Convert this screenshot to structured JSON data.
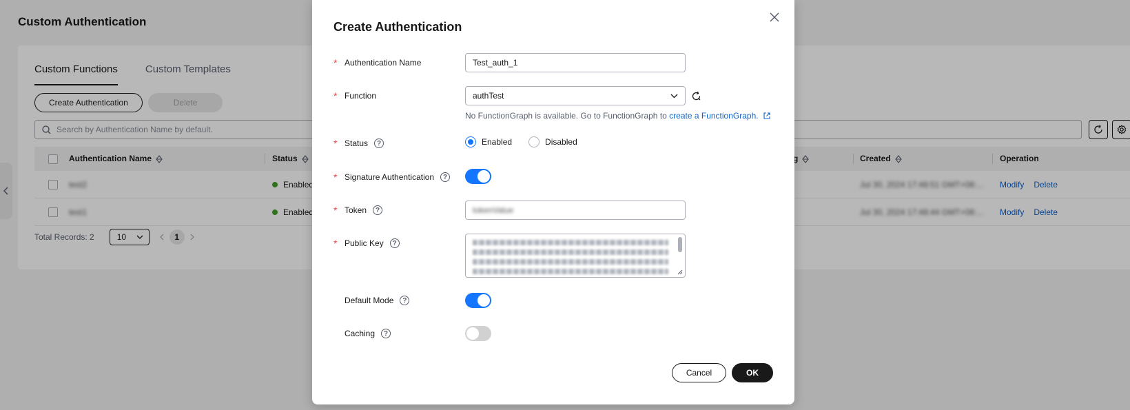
{
  "page": {
    "title": "Custom Authentication",
    "tabs": [
      {
        "label": "Custom Functions",
        "active": true
      },
      {
        "label": "Custom Templates",
        "active": false
      }
    ],
    "create_button": "Create Authentication",
    "delete_button": "Delete",
    "search_placeholder": "Search by Authentication Name by default.",
    "columns": {
      "name": "Authentication Name",
      "status": "Status",
      "partial": "g",
      "created": "Created",
      "operation": "Operation"
    },
    "rows": [
      {
        "name": "test2",
        "status": "Enabled",
        "created": "Jul 30, 2024 17:48:51 GMT+08:...",
        "modify": "Modify",
        "delete": "Delete"
      },
      {
        "name": "test1",
        "status": "Enabled",
        "created": "Jul 30, 2024 17:48:44 GMT+08:...",
        "modify": "Modify",
        "delete": "Delete"
      }
    ],
    "pager": {
      "total": "Total Records: 2",
      "page_size": "10",
      "current_page": "1"
    }
  },
  "modal": {
    "title": "Create Authentication",
    "fields": {
      "name": {
        "label": "Authentication Name",
        "value": "Test_auth_1"
      },
      "function": {
        "label": "Function",
        "value": "authTest",
        "hint": "No FunctionGraph is available. Go to FunctionGraph to",
        "hint_link": "create a FunctionGraph."
      },
      "status": {
        "label": "Status",
        "option_enabled": "Enabled",
        "option_disabled": "Disabled",
        "selected": "Enabled"
      },
      "signature": {
        "label": "Signature Authentication",
        "on": true
      },
      "token": {
        "label": "Token",
        "value": "tokenValue"
      },
      "public_key": {
        "label": "Public Key"
      },
      "default_mode": {
        "label": "Default Mode",
        "on": true
      },
      "caching": {
        "label": "Caching",
        "on": false
      }
    },
    "cancel": "Cancel",
    "ok": "OK"
  },
  "colors": {
    "accent": "#1476ff",
    "link": "#0f61c7",
    "required": "#e54545",
    "status_enabled": "#44a028"
  }
}
